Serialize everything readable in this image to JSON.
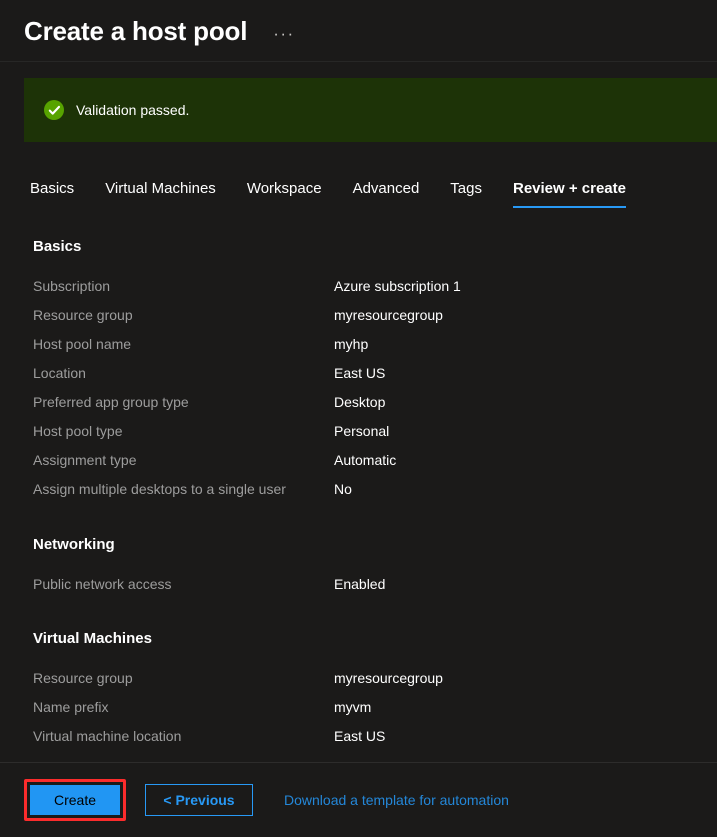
{
  "header": {
    "title": "Create a host pool",
    "more_menu": "···"
  },
  "banner": {
    "icon": "success-check-icon",
    "text": "Validation passed.",
    "background_color": "#1d3307",
    "icon_color": "#57a300"
  },
  "tabs": [
    {
      "label": "Basics",
      "active": false
    },
    {
      "label": "Virtual Machines",
      "active": false
    },
    {
      "label": "Workspace",
      "active": false
    },
    {
      "label": "Advanced",
      "active": false
    },
    {
      "label": "Tags",
      "active": false
    },
    {
      "label": "Review + create",
      "active": true
    }
  ],
  "sections": [
    {
      "heading": "Basics",
      "rows": [
        {
          "label": "Subscription",
          "value": "Azure subscription 1"
        },
        {
          "label": "Resource group",
          "value": "myresourcegroup"
        },
        {
          "label": "Host pool name",
          "value": "myhp"
        },
        {
          "label": "Location",
          "value": "East US"
        },
        {
          "label": "Preferred app group type",
          "value": "Desktop"
        },
        {
          "label": "Host pool type",
          "value": "Personal"
        },
        {
          "label": "Assignment type",
          "value": "Automatic"
        },
        {
          "label": "Assign multiple desktops to a single user",
          "value": "No"
        }
      ]
    },
    {
      "heading": "Networking",
      "rows": [
        {
          "label": "Public network access",
          "value": "Enabled"
        }
      ]
    },
    {
      "heading": "Virtual Machines",
      "rows": [
        {
          "label": "Resource group",
          "value": "myresourcegroup"
        },
        {
          "label": "Name prefix",
          "value": "myvm"
        },
        {
          "label": "Virtual machine location",
          "value": "East US"
        }
      ]
    }
  ],
  "footer": {
    "create_label": "Create",
    "previous_label": "< Previous",
    "download_label": "Download a template for automation",
    "highlight_color": "#fb2c2c",
    "create_color": "#2196f3",
    "link_color": "#2487d8"
  }
}
